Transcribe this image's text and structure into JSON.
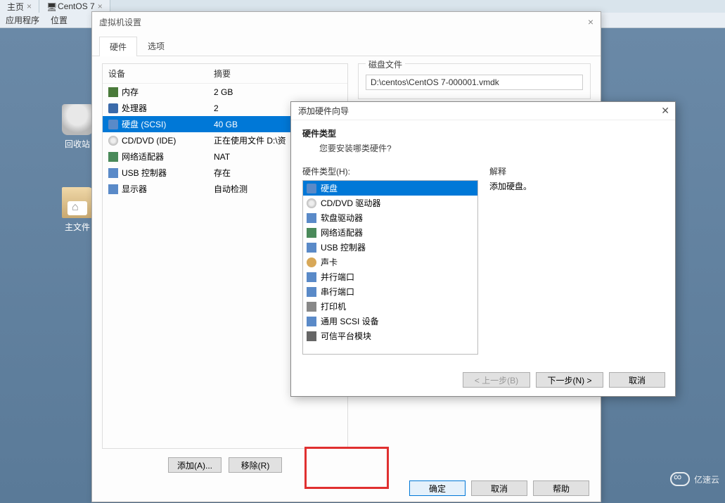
{
  "desktop_tabs": [
    {
      "label": "主页",
      "closable": true
    },
    {
      "label": "CentOS 7",
      "closable": true
    }
  ],
  "menubar": {
    "apps": "应用程序",
    "location": "位置"
  },
  "desktop_icons": {
    "trash": "回收站",
    "home": "主文件"
  },
  "settings": {
    "title": "虚拟机设置",
    "tabs": {
      "hardware": "硬件",
      "options": "选项"
    },
    "columns": {
      "device": "设备",
      "summary": "摘要"
    },
    "rows": [
      {
        "icon": "memory-icon",
        "device": "内存",
        "summary": "2 GB"
      },
      {
        "icon": "cpu-icon",
        "device": "处理器",
        "summary": "2"
      },
      {
        "icon": "disk-icon",
        "device": "硬盘 (SCSI)",
        "summary": "40 GB",
        "selected": true
      },
      {
        "icon": "cd-icon",
        "device": "CD/DVD (IDE)",
        "summary": "正在使用文件 D:\\资"
      },
      {
        "icon": "net-icon",
        "device": "网络适配器",
        "summary": "NAT"
      },
      {
        "icon": "usb-icon",
        "device": "USB 控制器",
        "summary": "存在"
      },
      {
        "icon": "display-icon",
        "device": "显示器",
        "summary": "自动检测"
      }
    ],
    "add_btn": "添加(A)...",
    "remove_btn": "移除(R)",
    "disk_file_label": "磁盘文件",
    "disk_file_path": "D:\\centos\\CentOS 7-000001.vmdk",
    "ok_btn": "确定",
    "cancel_btn": "取消",
    "help_btn": "帮助"
  },
  "wizard": {
    "title": "添加硬件向导",
    "header": "硬件类型",
    "subtitle": "您要安装哪类硬件?",
    "list_label": "硬件类型(H):",
    "explain_label": "解释",
    "explain_text": "添加硬盘。",
    "items": [
      {
        "icon": "disk-icon",
        "label": "硬盘",
        "selected": true
      },
      {
        "icon": "cd-icon",
        "label": "CD/DVD 驱动器"
      },
      {
        "icon": "floppy-icon",
        "label": "软盘驱动器"
      },
      {
        "icon": "net-icon",
        "label": "网络适配器"
      },
      {
        "icon": "usb-icon",
        "label": "USB 控制器"
      },
      {
        "icon": "sound-icon",
        "label": "声卡"
      },
      {
        "icon": "parallel-icon",
        "label": "并行端口"
      },
      {
        "icon": "serial-icon",
        "label": "串行端口"
      },
      {
        "icon": "printer-icon",
        "label": "打印机"
      },
      {
        "icon": "scsi-icon",
        "label": "通用 SCSI 设备"
      },
      {
        "icon": "tpm-icon",
        "label": "可信平台模块"
      }
    ],
    "back_btn": "< 上一步(B)",
    "next_btn": "下一步(N) >",
    "cancel_btn": "取消"
  },
  "watermark": "亿速云"
}
